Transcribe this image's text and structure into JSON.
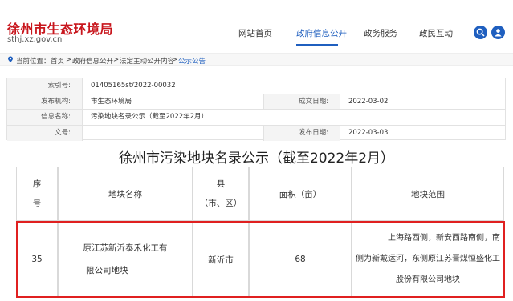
{
  "site": {
    "title": "徐州市生态环境局",
    "url": "sthj.xz.gov.cn"
  },
  "nav": {
    "items": [
      {
        "label": "网站首页",
        "active": false
      },
      {
        "label": "政府信息公开",
        "active": true
      },
      {
        "label": "政务服务",
        "active": false
      },
      {
        "label": "政民互动",
        "active": false
      }
    ],
    "search_icon": "search-icon",
    "user_icon": "user-icon"
  },
  "breadcrumb": {
    "prefix": "当前位置：",
    "items": [
      "首页",
      "政府信息公开",
      "法定主动公开内容",
      "公示公告"
    ],
    "separator": ">"
  },
  "meta": {
    "index_label": "索引号:",
    "index_value": "01405165st/2022-00032",
    "publisher_label": "发布机构:",
    "publisher_value": "市生态环境局",
    "date_created_label": "成文日期:",
    "date_created_value": "2022-03-02",
    "info_name_label": "信息名称:",
    "info_name_value": "污染地块名录公示（截至2022年2月）",
    "doc_no_label": "文号:",
    "doc_no_value": "",
    "date_published_label": "发布日期:",
    "date_published_value": "2022-03-03"
  },
  "document": {
    "title": "徐州市污染地块名录公示（截至2022年2月）"
  },
  "table": {
    "headers": {
      "seq_a": "序",
      "seq_b": "号",
      "name": "地块名称",
      "county_a": "县",
      "county_b": "（市、区）",
      "area": "面积（亩）",
      "scope": "地块范围"
    },
    "row": {
      "seq": "35",
      "name_a": "原江苏新沂泰禾化工有",
      "name_b": "限公司地块",
      "county": "新沂市",
      "area": "68",
      "scope_a": "上海路西侧，新安西路南侧，南",
      "scope_b": "侧为新戴运河，东侧原江苏晋煤恒盛化工",
      "scope_c": "股份有限公司地块"
    }
  },
  "colors": {
    "brand_red": "#c8161d",
    "link_blue": "#1f5fbf",
    "highlight_red": "#e02020"
  }
}
